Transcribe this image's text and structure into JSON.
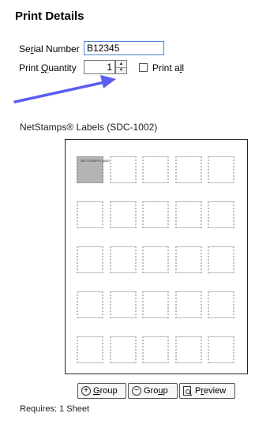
{
  "header": {
    "title": "Print Details"
  },
  "form": {
    "serial": {
      "label_pre": "Se",
      "label_u": "r",
      "label_post": "ial Number",
      "value": "B12345"
    },
    "quantity": {
      "label_pre": "Print ",
      "label_u": "Q",
      "label_post": "uantity",
      "value": "1"
    },
    "print_all": {
      "label_pre": "Print a",
      "label_u": "l",
      "label_post": "l",
      "checked": false
    }
  },
  "sheet": {
    "label": "NetStamps® Labels (SDC-1002)",
    "rows": 5,
    "cols": 5,
    "selected_text": "NETSTAMPS LABEL"
  },
  "buttons": {
    "add_group": {
      "pre": "",
      "u": "G",
      "post": "roup"
    },
    "remove_group": {
      "pre": "Gro",
      "u": "u",
      "post": "p"
    },
    "preview": {
      "pre": "P",
      "u": "r",
      "post": "eview"
    }
  },
  "footer": {
    "requires": "Requires: 1 Sheet"
  },
  "colors": {
    "arrow": "#5b5ef0",
    "focus_border": "#4a86d4"
  },
  "icons": [
    "annotation-arrow-icon",
    "spin-up-icon",
    "spin-down-icon",
    "plus-circle-icon",
    "minus-circle-icon",
    "preview-icon"
  ]
}
